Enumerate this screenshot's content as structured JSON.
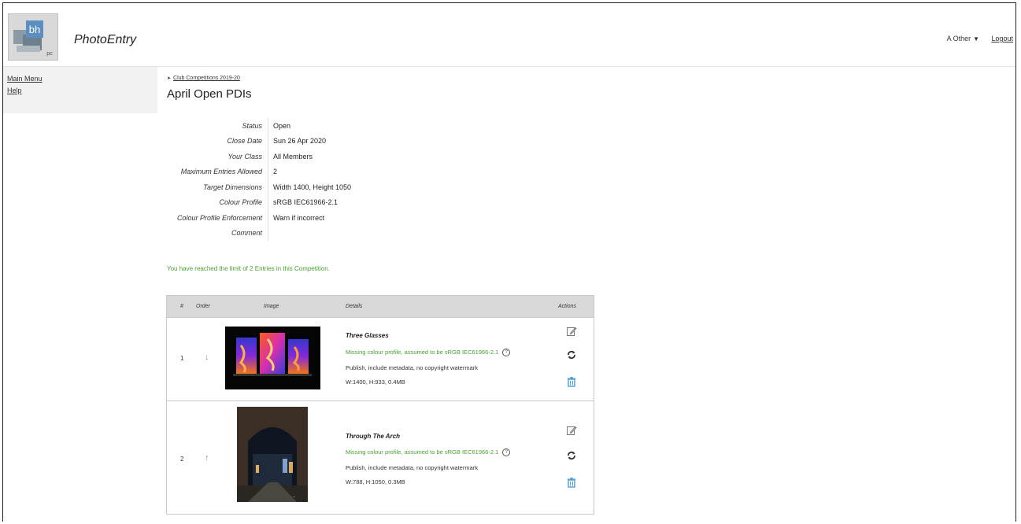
{
  "header": {
    "logo_text": "bh",
    "logo_subtext": "pc",
    "app_title": "PhotoEntry",
    "user_name": "A Other",
    "user_caret": "▼",
    "logout_label": "Logout"
  },
  "sidebar": {
    "items": [
      {
        "label": "Main Menu"
      },
      {
        "label": "Help"
      }
    ]
  },
  "breadcrumb": {
    "arrow": "➤",
    "label": "Club Competitions 2019-20"
  },
  "page_title": "April Open PDIs",
  "competition": {
    "fields": [
      {
        "label": "Status",
        "value": "Open"
      },
      {
        "label": "Close Date",
        "value": "Sun 26 Apr 2020"
      },
      {
        "label": "Your Class",
        "value": "All Members"
      },
      {
        "label": "Maximum Entries Allowed",
        "value": "2"
      },
      {
        "label": "Target Dimensions",
        "value": "Width 1400, Height 1050"
      },
      {
        "label": "Colour Profile",
        "value": "sRGB IEC61966-2.1"
      },
      {
        "label": "Colour Profile Enforcement",
        "value": "Warn if incorrect"
      },
      {
        "label": "Comment",
        "value": ""
      }
    ]
  },
  "limit_message": "You have reached the limit of 2 Entries in this Competition.",
  "entries_table": {
    "headers": {
      "num": "#",
      "order": "Order",
      "image": "Image",
      "details": "Details",
      "actions": "Actions"
    },
    "rows": [
      {
        "num": "1",
        "order_arrow": "↓",
        "title": "Three Glasses",
        "warning": "Missing colour profile, assumed to be sRGB IEC61966-2.1",
        "publish": "Publish, include metadata, no copyright watermark",
        "size": "W:1400, H:933, 0.4MB"
      },
      {
        "num": "2",
        "order_arrow": "↑",
        "title": "Through The Arch",
        "warning": "Missing colour profile, assumed to be sRGB IEC61966-2.1",
        "publish": "Publish, include metadata, no copyright watermark",
        "size": "W:788, H:1050, 0.3MB"
      }
    ]
  },
  "colors": {
    "success_text": "#4aa032",
    "link_arrow": "#5aa0e6",
    "delete_icon": "#4a9fd8",
    "table_header_bg": "#d9d9d9",
    "sidebar_bg": "#f2f2f2"
  },
  "icons": {
    "edit": "edit-icon",
    "replace": "refresh-icon",
    "delete": "trash-icon",
    "help": "question-circle-icon",
    "help_glyph": "?"
  }
}
